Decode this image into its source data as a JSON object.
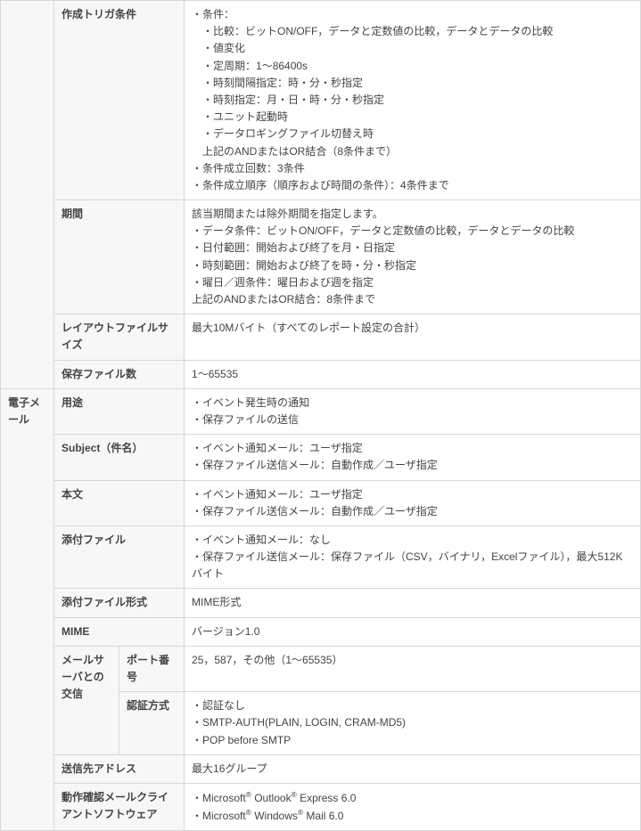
{
  "section1": {
    "r1": {
      "label": "作成トリガ条件",
      "lines": [
        "・条件：",
        "　・比較：ビットON/OFF，データと定数値の比較，データとデータの比較",
        "　・値変化",
        "　・定周期：1～86400s",
        "　・時刻間隔指定：時・分・秒指定",
        "　・時刻指定：月・日・時・分・秒指定",
        "　・ユニット起動時",
        "　・データロギングファイル切替え時",
        "　上記のANDまたはOR結合（8条件まで）",
        "・条件成立回数：3条件",
        "・条件成立順序（順序および時間の条件）：4条件まで"
      ]
    },
    "r2": {
      "label": "期間",
      "lines": [
        "該当期間または除外期間を指定します。",
        "・データ条件：ビットON/OFF，データと定数値の比較，データとデータの比較",
        "・日付範囲：開始および終了を月・日指定",
        "・時刻範囲：開始および終了を時・分・秒指定",
        "・曜日／週条件：曜日および週を指定",
        "上記のANDまたはOR結合：8条件まで"
      ]
    },
    "r3": {
      "label": "レイアウトファイルサイズ",
      "val": "最大10Mバイト（すべてのレポート設定の合計）"
    },
    "r4": {
      "label": "保存ファイル数",
      "val": "1～65535"
    }
  },
  "section2": {
    "cat": "電子メール",
    "r1": {
      "label": "用途",
      "lines": [
        "・イベント発生時の通知",
        "・保存ファイルの送信"
      ]
    },
    "r2": {
      "label": "Subject（件名）",
      "lines": [
        "・イベント通知メール：ユーザ指定",
        "・保存ファイル送信メール：自動作成／ユーザ指定"
      ]
    },
    "r3": {
      "label": "本文",
      "lines": [
        "・イベント通知メール：ユーザ指定",
        "・保存ファイル送信メール：自動作成／ユーザ指定"
      ]
    },
    "r4": {
      "label": "添付ファイル",
      "lines": [
        "・イベント通知メール：なし",
        "・保存ファイル送信メール：保存ファイル（CSV，バイナリ，Excelファイル），最大512Kバイト"
      ]
    },
    "r5": {
      "label": "添付ファイル形式",
      "val": "MIME形式"
    },
    "r6": {
      "label": "MIME",
      "val": "バージョン1.0"
    },
    "r7": {
      "label": "メールサーバとの交信",
      "sub1": {
        "label": "ポート番号",
        "val": "25，587，その他（1～65535）"
      },
      "sub2": {
        "label": "認証方式",
        "lines": [
          "・認証なし",
          "・SMTP-AUTH(PLAIN, LOGIN, CRAM-MD5)",
          "・POP before SMTP"
        ]
      }
    },
    "r8": {
      "label": "送信先アドレス",
      "val": "最大16グループ"
    },
    "r9": {
      "label": "動作確認メールクライアントソフトウェア",
      "html": "・Microsoft<sup>®</sup> Outlook<sup>®</sup> Express 6.0<br>・Microsoft<sup>®</sup> Windows<sup>®</sup> Mail 6.0"
    }
  }
}
